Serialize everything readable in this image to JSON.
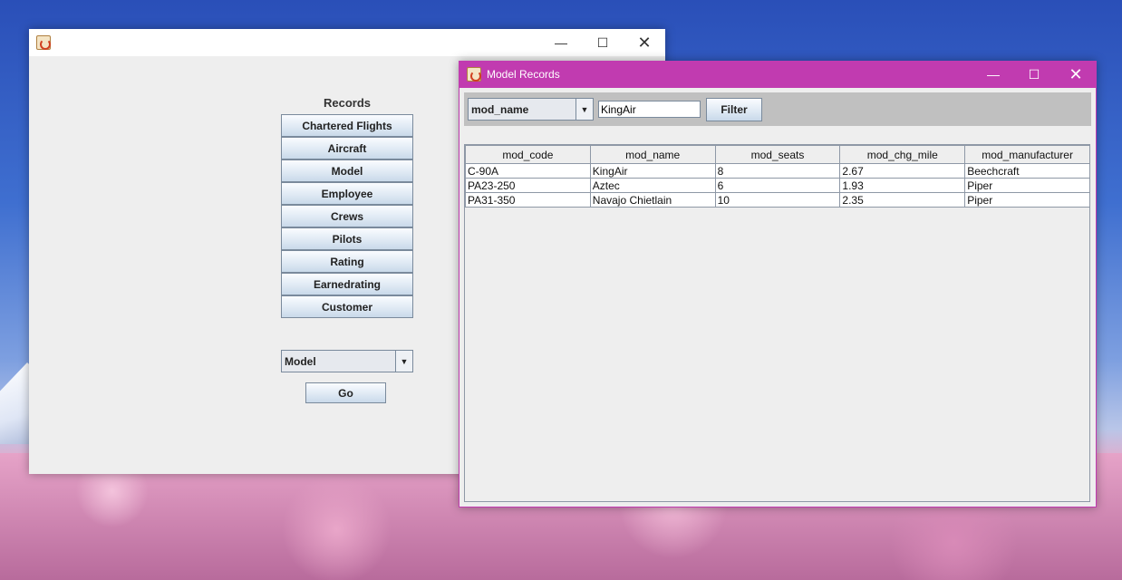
{
  "main_window": {
    "title": "",
    "heading": "Records",
    "buttons": [
      "Chartered Flights",
      "Aircraft",
      "Model",
      "Employee",
      "Crews",
      "Pilots",
      "Rating",
      "Earnedrating",
      "Customer"
    ],
    "table_select": "Model",
    "go_label": "Go"
  },
  "model_window": {
    "title": "Model Records",
    "filter_column": "mod_name",
    "filter_value": "KingAir",
    "filter_label": "Filter",
    "columns": [
      "mod_code",
      "mod_name",
      "mod_seats",
      "mod_chg_mile",
      "mod_manufacturer"
    ],
    "rows": [
      [
        "C-90A",
        "KingAir",
        "8",
        "2.67",
        "Beechcraft"
      ],
      [
        "PA23-250",
        "Aztec",
        "6",
        "1.93",
        "Piper"
      ],
      [
        "PA31-350",
        "Navajo Chietlain",
        "10",
        "2.35",
        "Piper"
      ]
    ]
  },
  "colors": {
    "title_accent": "#c13bb0"
  }
}
